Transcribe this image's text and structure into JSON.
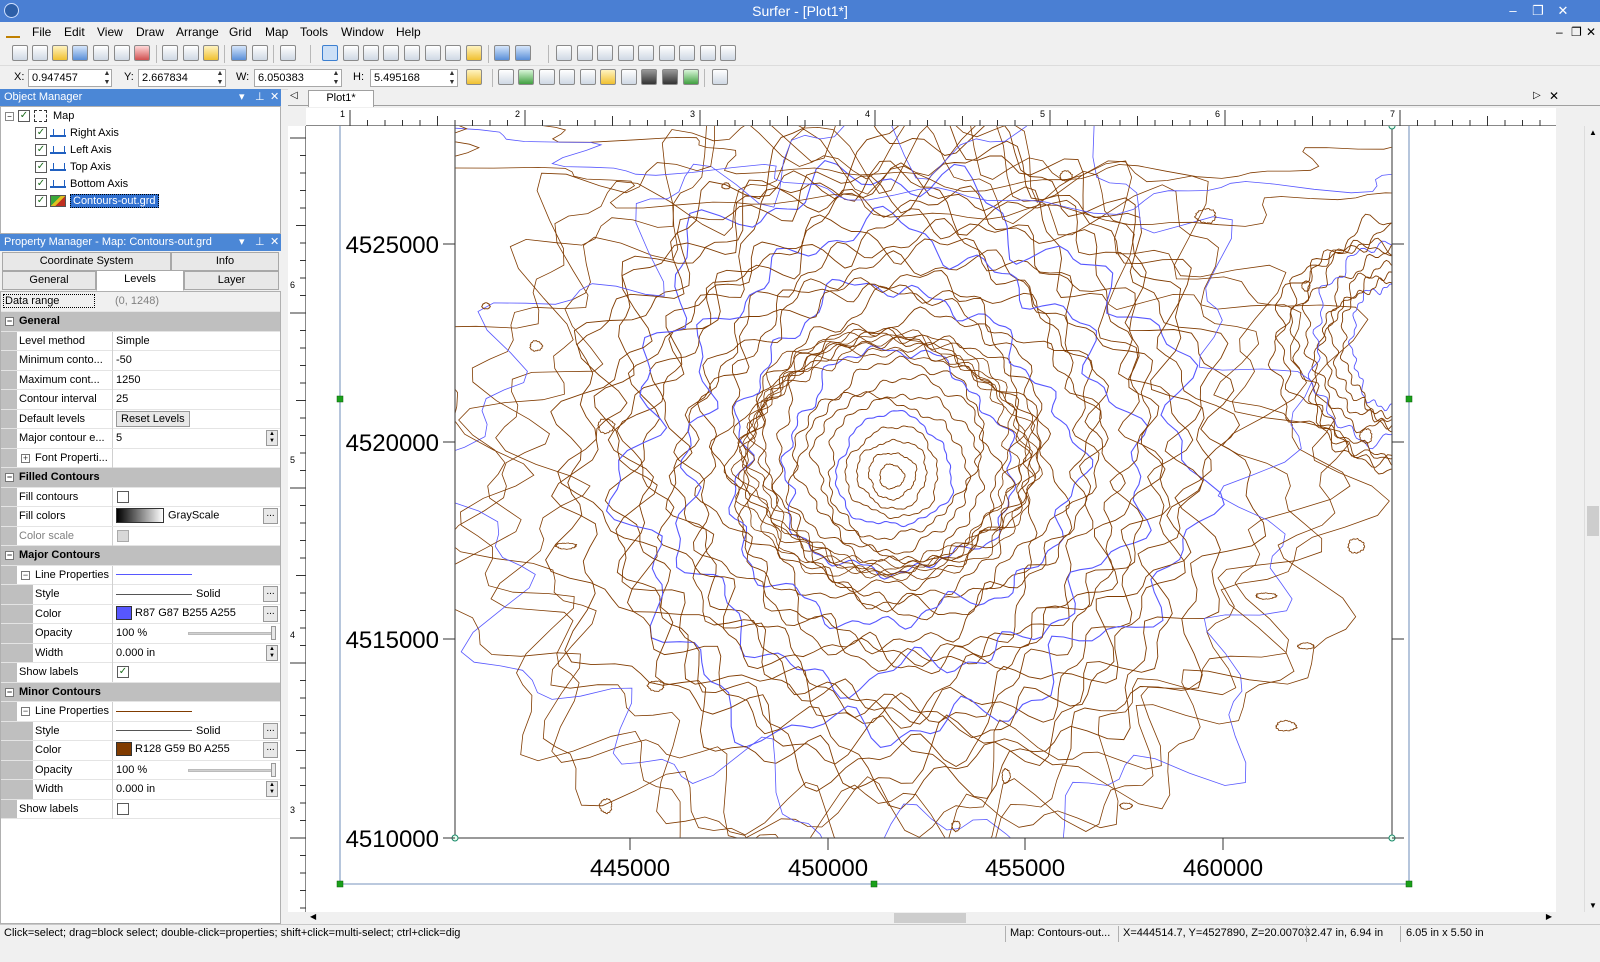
{
  "app": {
    "title": "Surfer - [Plot1*]"
  },
  "window_controls": {
    "minimize": "–",
    "restore": "❐",
    "close": "✕",
    "mdi_minimize": "–",
    "mdi_restore": "❐",
    "mdi_close": "✕"
  },
  "menu": [
    "File",
    "Edit",
    "View",
    "Draw",
    "Arrange",
    "Grid",
    "Map",
    "Tools",
    "Window",
    "Help"
  ],
  "coords": {
    "x_label": "X:",
    "x_value": "0.947457",
    "y_label": "Y:",
    "y_value": "2.667834",
    "w_label": "W:",
    "w_value": "6.050383",
    "h_label": "H:",
    "h_value": "5.495168"
  },
  "object_manager": {
    "title": "Object Manager",
    "items": [
      {
        "label": "Map",
        "checked": true
      },
      {
        "label": "Right Axis",
        "checked": true
      },
      {
        "label": "Left Axis",
        "checked": true
      },
      {
        "label": "Top Axis",
        "checked": true
      },
      {
        "label": "Bottom Axis",
        "checked": true
      },
      {
        "label": "Contours-out.grd",
        "checked": true,
        "selected": true
      }
    ]
  },
  "property_manager": {
    "title": "Property Manager - Map: Contours-out.grd",
    "tabs_top": [
      "Coordinate System",
      "Info"
    ],
    "tabs_bottom": [
      "General",
      "Levels",
      "Layer"
    ],
    "active_tab": "Levels",
    "data_range_label": "Data range",
    "data_range_value": "(0, 1248)",
    "sections": {
      "general": "General",
      "filled": "Filled Contours",
      "major": "Major Contours",
      "minor": "Minor Contours"
    },
    "rows": {
      "level_method": {
        "name": "Level method",
        "value": "Simple"
      },
      "min_contour": {
        "name": "Minimum conto...",
        "value": "-50"
      },
      "max_contour": {
        "name": "Maximum cont...",
        "value": "1250"
      },
      "contour_interval": {
        "name": "Contour interval",
        "value": "25"
      },
      "default_levels": {
        "name": "Default levels",
        "value": "Reset Levels"
      },
      "major_every": {
        "name": "Major contour e...",
        "value": "5"
      },
      "font_properties": {
        "name": "Font Properti..."
      },
      "fill_contours": {
        "name": "Fill contours",
        "checked": false
      },
      "fill_colors": {
        "name": "Fill colors",
        "value": "GrayScale"
      },
      "color_scale": {
        "name": "Color scale",
        "checked": false
      },
      "major_line_props": {
        "name": "Line Properties"
      },
      "major_style": {
        "name": "Style",
        "value": "Solid"
      },
      "major_color": {
        "name": "Color",
        "value": "R87 G87 B255 A255",
        "swatch": "#5757ff"
      },
      "major_opacity": {
        "name": "Opacity",
        "value": "100 %",
        "level": 1.0
      },
      "major_width": {
        "name": "Width",
        "value": "0.000 in"
      },
      "major_show_labels": {
        "name": "Show labels",
        "checked": true
      },
      "minor_line_props": {
        "name": "Line Properties"
      },
      "minor_style": {
        "name": "Style",
        "value": "Solid"
      },
      "minor_color": {
        "name": "Color",
        "value": "R128 G59 B0 A255",
        "swatch": "#803b00"
      },
      "minor_opacity": {
        "name": "Opacity",
        "value": "100 %",
        "level": 1.0
      },
      "minor_width": {
        "name": "Width",
        "value": "0.000 in"
      },
      "minor_show_labels": {
        "name": "Show labels",
        "checked": false
      }
    }
  },
  "document": {
    "tab": "Plot1*",
    "ruler_h": [
      "1",
      "2",
      "3",
      "4",
      "5",
      "6",
      "7"
    ],
    "ruler_v": [
      "6",
      "5",
      "4",
      "3"
    ],
    "y_ticks": [
      "4525000",
      "4520000",
      "4515000",
      "4510000"
    ],
    "x_ticks": [
      "445000",
      "450000",
      "455000",
      "460000"
    ]
  },
  "colors": {
    "major_contour": "#5757ff",
    "minor_contour": "#803b00",
    "title_bar": "#4a7fd3",
    "panel_header": "#4b87d6"
  },
  "status": {
    "hint": "Click=select; drag=block select; double-click=properties; shift+click=multi-select; ctrl+click=dig",
    "object": "Map: Contours-out...",
    "xyz": "X=444514.7, Y=4527890, Z=20.00703",
    "position": "2.47 in, 6.94 in",
    "size": "6.05 in x 5.50 in"
  }
}
